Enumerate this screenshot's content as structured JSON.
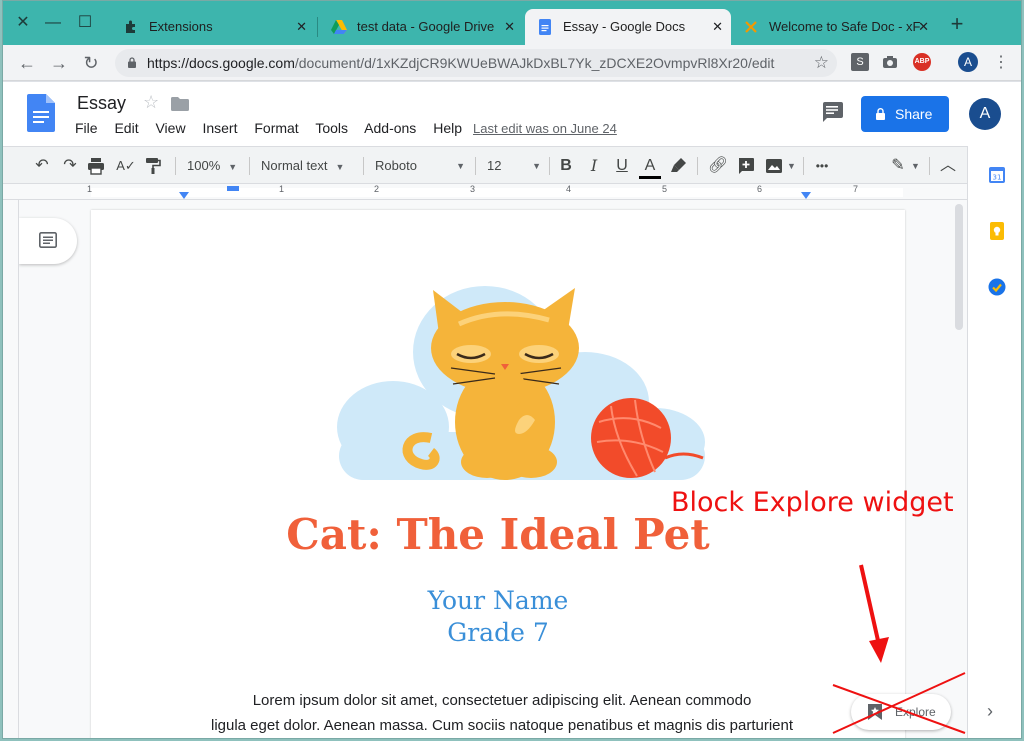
{
  "browser": {
    "tabs": [
      {
        "title": "Extensions",
        "icon": "puzzle-icon"
      },
      {
        "title": "test data - Google Drive",
        "icon": "drive-icon"
      },
      {
        "title": "Essay - Google Docs",
        "icon": "docs-icon",
        "active": true
      },
      {
        "title": "Welcome to Safe Doc - xF",
        "icon": "safedoc-icon"
      }
    ],
    "new_tab_label": "+",
    "url_host": "https://docs.google.com",
    "url_path": "/document/d/1xKZdjCR9KWUeBWAJkDxBL7Yk_zDCXE2OvmpvRl8Xr20/edit",
    "extensions": [
      "S",
      "ABP"
    ],
    "profile_initial": "A"
  },
  "docs": {
    "title": "Essay",
    "menu": [
      "File",
      "Edit",
      "View",
      "Insert",
      "Format",
      "Tools",
      "Add-ons",
      "Help"
    ],
    "last_edit": "Last edit was on June 24",
    "share_label": "Share",
    "avatar_initial": "A"
  },
  "toolbar": {
    "zoom": "100%",
    "style": "Normal text",
    "font": "Roboto",
    "size": "12",
    "bold": "B",
    "italic": "I",
    "underline": "U",
    "text_color": "A",
    "more": "•••"
  },
  "ruler_numbers": [
    "1",
    "1",
    "2",
    "3",
    "4",
    "5",
    "6",
    "7"
  ],
  "document": {
    "heading": "Cat: The Ideal Pet",
    "name": "Your Name",
    "grade": "Grade 7",
    "body_line1": "Lorem ipsum dolor sit amet, consectetuer adipiscing elit. Aenean commodo",
    "body_line2": "ligula eget dolor. Aenean massa. Cum sociis natoque penatibus et magnis dis parturient"
  },
  "explore": {
    "label": "Explore"
  },
  "annotation": {
    "text": "Block Explore widget",
    "color": "#ee1111"
  },
  "colors": {
    "accent": "#1a73e8",
    "heading": "#f0603a",
    "subheading": "#3a8fd8",
    "tabstrip": "#3db5ad"
  }
}
